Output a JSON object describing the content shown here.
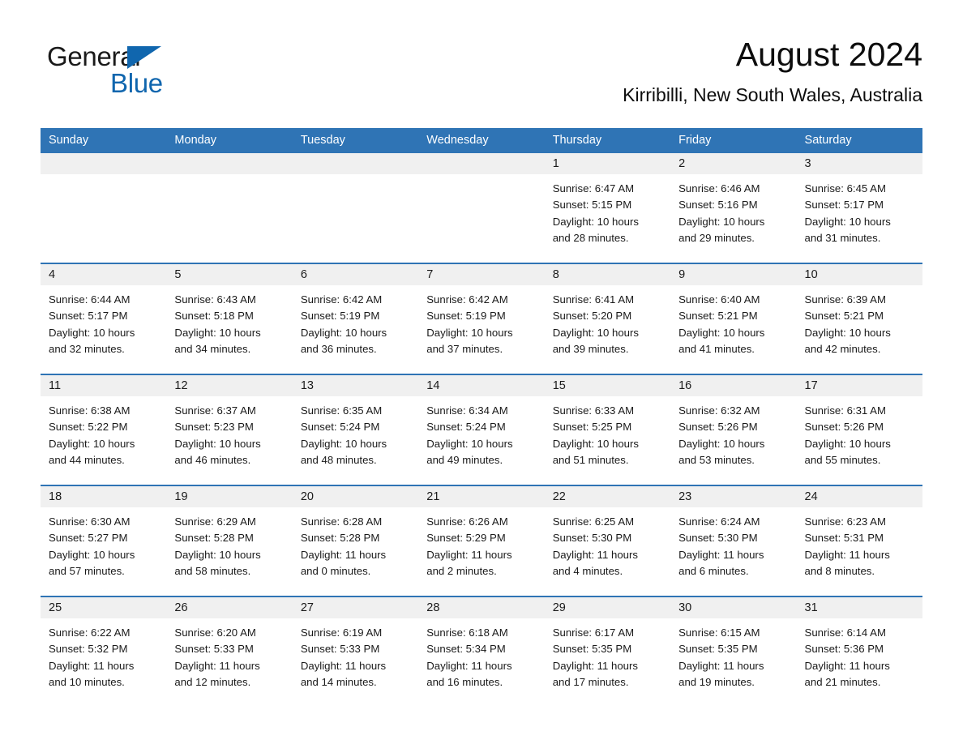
{
  "brand": {
    "name_part1": "General",
    "name_part2": "Blue",
    "triangle_color": "#1066ae",
    "text_color": "#1a1a1a"
  },
  "header": {
    "title": "August 2024",
    "subtitle": "Kirribilli, New South Wales, Australia",
    "accent_color": "#2f74b5",
    "day_row_bg": "#f0f0f0"
  },
  "calendar": {
    "weekday_headers": [
      "Sunday",
      "Monday",
      "Tuesday",
      "Wednesday",
      "Thursday",
      "Friday",
      "Saturday"
    ],
    "weeks": [
      [
        {
          "day": "",
          "lines": []
        },
        {
          "day": "",
          "lines": []
        },
        {
          "day": "",
          "lines": []
        },
        {
          "day": "",
          "lines": []
        },
        {
          "day": "1",
          "lines": [
            "Sunrise: 6:47 AM",
            "Sunset: 5:15 PM",
            "Daylight: 10 hours",
            "and 28 minutes."
          ]
        },
        {
          "day": "2",
          "lines": [
            "Sunrise: 6:46 AM",
            "Sunset: 5:16 PM",
            "Daylight: 10 hours",
            "and 29 minutes."
          ]
        },
        {
          "day": "3",
          "lines": [
            "Sunrise: 6:45 AM",
            "Sunset: 5:17 PM",
            "Daylight: 10 hours",
            "and 31 minutes."
          ]
        }
      ],
      [
        {
          "day": "4",
          "lines": [
            "Sunrise: 6:44 AM",
            "Sunset: 5:17 PM",
            "Daylight: 10 hours",
            "and 32 minutes."
          ]
        },
        {
          "day": "5",
          "lines": [
            "Sunrise: 6:43 AM",
            "Sunset: 5:18 PM",
            "Daylight: 10 hours",
            "and 34 minutes."
          ]
        },
        {
          "day": "6",
          "lines": [
            "Sunrise: 6:42 AM",
            "Sunset: 5:19 PM",
            "Daylight: 10 hours",
            "and 36 minutes."
          ]
        },
        {
          "day": "7",
          "lines": [
            "Sunrise: 6:42 AM",
            "Sunset: 5:19 PM",
            "Daylight: 10 hours",
            "and 37 minutes."
          ]
        },
        {
          "day": "8",
          "lines": [
            "Sunrise: 6:41 AM",
            "Sunset: 5:20 PM",
            "Daylight: 10 hours",
            "and 39 minutes."
          ]
        },
        {
          "day": "9",
          "lines": [
            "Sunrise: 6:40 AM",
            "Sunset: 5:21 PM",
            "Daylight: 10 hours",
            "and 41 minutes."
          ]
        },
        {
          "day": "10",
          "lines": [
            "Sunrise: 6:39 AM",
            "Sunset: 5:21 PM",
            "Daylight: 10 hours",
            "and 42 minutes."
          ]
        }
      ],
      [
        {
          "day": "11",
          "lines": [
            "Sunrise: 6:38 AM",
            "Sunset: 5:22 PM",
            "Daylight: 10 hours",
            "and 44 minutes."
          ]
        },
        {
          "day": "12",
          "lines": [
            "Sunrise: 6:37 AM",
            "Sunset: 5:23 PM",
            "Daylight: 10 hours",
            "and 46 minutes."
          ]
        },
        {
          "day": "13",
          "lines": [
            "Sunrise: 6:35 AM",
            "Sunset: 5:24 PM",
            "Daylight: 10 hours",
            "and 48 minutes."
          ]
        },
        {
          "day": "14",
          "lines": [
            "Sunrise: 6:34 AM",
            "Sunset: 5:24 PM",
            "Daylight: 10 hours",
            "and 49 minutes."
          ]
        },
        {
          "day": "15",
          "lines": [
            "Sunrise: 6:33 AM",
            "Sunset: 5:25 PM",
            "Daylight: 10 hours",
            "and 51 minutes."
          ]
        },
        {
          "day": "16",
          "lines": [
            "Sunrise: 6:32 AM",
            "Sunset: 5:26 PM",
            "Daylight: 10 hours",
            "and 53 minutes."
          ]
        },
        {
          "day": "17",
          "lines": [
            "Sunrise: 6:31 AM",
            "Sunset: 5:26 PM",
            "Daylight: 10 hours",
            "and 55 minutes."
          ]
        }
      ],
      [
        {
          "day": "18",
          "lines": [
            "Sunrise: 6:30 AM",
            "Sunset: 5:27 PM",
            "Daylight: 10 hours",
            "and 57 minutes."
          ]
        },
        {
          "day": "19",
          "lines": [
            "Sunrise: 6:29 AM",
            "Sunset: 5:28 PM",
            "Daylight: 10 hours",
            "and 58 minutes."
          ]
        },
        {
          "day": "20",
          "lines": [
            "Sunrise: 6:28 AM",
            "Sunset: 5:28 PM",
            "Daylight: 11 hours",
            "and 0 minutes."
          ]
        },
        {
          "day": "21",
          "lines": [
            "Sunrise: 6:26 AM",
            "Sunset: 5:29 PM",
            "Daylight: 11 hours",
            "and 2 minutes."
          ]
        },
        {
          "day": "22",
          "lines": [
            "Sunrise: 6:25 AM",
            "Sunset: 5:30 PM",
            "Daylight: 11 hours",
            "and 4 minutes."
          ]
        },
        {
          "day": "23",
          "lines": [
            "Sunrise: 6:24 AM",
            "Sunset: 5:30 PM",
            "Daylight: 11 hours",
            "and 6 minutes."
          ]
        },
        {
          "day": "24",
          "lines": [
            "Sunrise: 6:23 AM",
            "Sunset: 5:31 PM",
            "Daylight: 11 hours",
            "and 8 minutes."
          ]
        }
      ],
      [
        {
          "day": "25",
          "lines": [
            "Sunrise: 6:22 AM",
            "Sunset: 5:32 PM",
            "Daylight: 11 hours",
            "and 10 minutes."
          ]
        },
        {
          "day": "26",
          "lines": [
            "Sunrise: 6:20 AM",
            "Sunset: 5:33 PM",
            "Daylight: 11 hours",
            "and 12 minutes."
          ]
        },
        {
          "day": "27",
          "lines": [
            "Sunrise: 6:19 AM",
            "Sunset: 5:33 PM",
            "Daylight: 11 hours",
            "and 14 minutes."
          ]
        },
        {
          "day": "28",
          "lines": [
            "Sunrise: 6:18 AM",
            "Sunset: 5:34 PM",
            "Daylight: 11 hours",
            "and 16 minutes."
          ]
        },
        {
          "day": "29",
          "lines": [
            "Sunrise: 6:17 AM",
            "Sunset: 5:35 PM",
            "Daylight: 11 hours",
            "and 17 minutes."
          ]
        },
        {
          "day": "30",
          "lines": [
            "Sunrise: 6:15 AM",
            "Sunset: 5:35 PM",
            "Daylight: 11 hours",
            "and 19 minutes."
          ]
        },
        {
          "day": "31",
          "lines": [
            "Sunrise: 6:14 AM",
            "Sunset: 5:36 PM",
            "Daylight: 11 hours",
            "and 21 minutes."
          ]
        }
      ]
    ]
  }
}
